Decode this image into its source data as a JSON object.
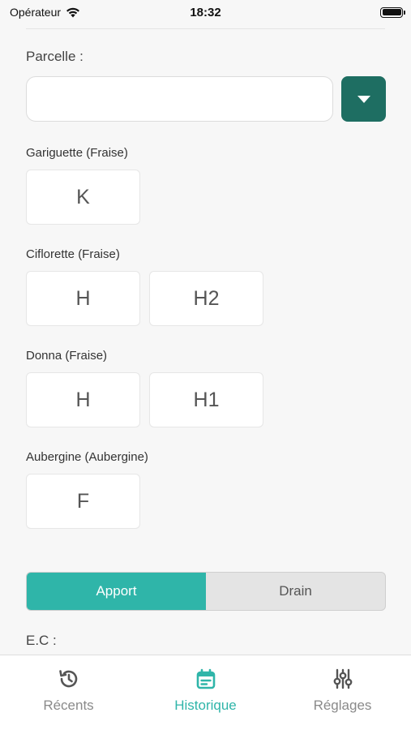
{
  "status_bar": {
    "carrier": "Opérateur",
    "time": "18:32"
  },
  "parcelle": {
    "label": "Parcelle :",
    "value": ""
  },
  "crops": [
    {
      "title": "Gariguette (Fraise)",
      "chips": [
        "K"
      ]
    },
    {
      "title": "Ciflorette (Fraise)",
      "chips": [
        "H",
        "H2"
      ]
    },
    {
      "title": "Donna (Fraise)",
      "chips": [
        "H",
        "H1"
      ]
    },
    {
      "title": "Aubergine (Aubergine)",
      "chips": [
        "F"
      ]
    }
  ],
  "segment": {
    "active": "Apport",
    "inactive": "Drain"
  },
  "ec_label": "E.C :",
  "tabs": [
    {
      "label": "Récents",
      "icon": "history-icon"
    },
    {
      "label": "Historique",
      "icon": "calendar-icon"
    },
    {
      "label": "Réglages",
      "icon": "sliders-icon"
    }
  ],
  "colors": {
    "accent": "#2fb5a9",
    "select_button": "#1e6e62",
    "inactive_tab": "#8a8a8a"
  }
}
